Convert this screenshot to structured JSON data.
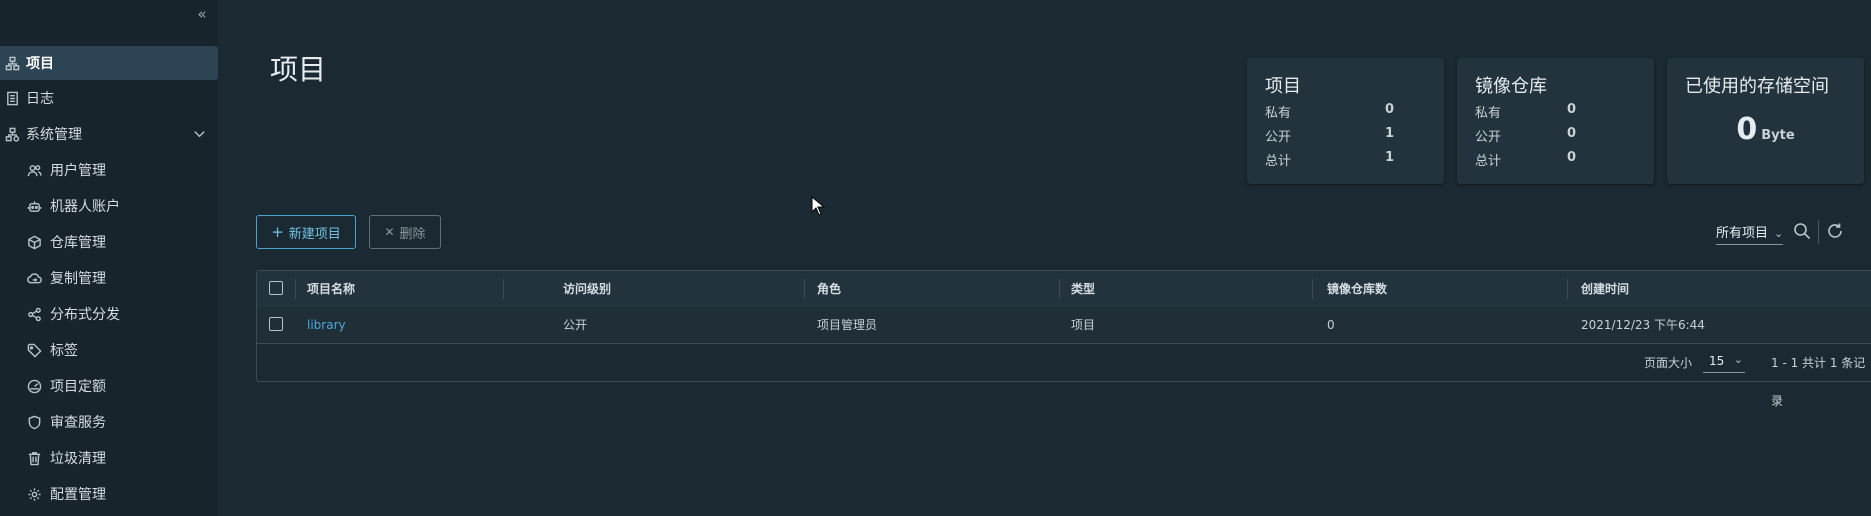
{
  "sidebar": {
    "items": [
      {
        "label": "项目",
        "icon": "projects-icon",
        "active": true
      },
      {
        "label": "日志",
        "icon": "logs-icon"
      },
      {
        "label": "系统管理",
        "icon": "admin-icon",
        "expanded": true
      },
      {
        "label": "用户管理",
        "icon": "users-icon"
      },
      {
        "label": "机器人账户",
        "icon": "robot-icon"
      },
      {
        "label": "仓库管理",
        "icon": "registry-icon"
      },
      {
        "label": "复制管理",
        "icon": "replication-icon"
      },
      {
        "label": "分布式分发",
        "icon": "share-icon"
      },
      {
        "label": "标签",
        "icon": "tag-icon"
      },
      {
        "label": "项目定额",
        "icon": "quota-icon"
      },
      {
        "label": "审查服务",
        "icon": "shield-icon"
      },
      {
        "label": "垃圾清理",
        "icon": "trash-icon"
      },
      {
        "label": "配置管理",
        "icon": "gear-icon"
      }
    ]
  },
  "main": {
    "title": "项目"
  },
  "cards": {
    "projects": {
      "title": "项目",
      "rows": [
        {
          "label": "私有",
          "value": "0"
        },
        {
          "label": "公开",
          "value": "1"
        },
        {
          "label": "总计",
          "value": "1"
        }
      ]
    },
    "repositories": {
      "title": "镜像仓库",
      "rows": [
        {
          "label": "私有",
          "value": "0"
        },
        {
          "label": "公开",
          "value": "0"
        },
        {
          "label": "总计",
          "value": "0"
        }
      ]
    },
    "storage": {
      "title": "已使用的存储空间",
      "value": "0",
      "unit": "Byte"
    }
  },
  "toolbar": {
    "new_label": "新建项目",
    "delete_label": "删除",
    "filter_label": "所有项目"
  },
  "table": {
    "columns": [
      "项目名称",
      "访问级别",
      "角色",
      "类型",
      "镜像仓库数",
      "创建时间"
    ],
    "rows": [
      {
        "name": "library",
        "access": "公开",
        "role": "项目管理员",
        "type": "项目",
        "repo_count": "0",
        "created": "2021/12/23 下午6:44"
      }
    ],
    "footer": {
      "page_size_label": "页面大小",
      "page_size": "15",
      "summary": "1 - 1 共计 1 条记录"
    }
  },
  "colors": {
    "background": "#1b2a32",
    "sidebar": "#17242c",
    "active_item": "#2c4454",
    "link": "#49a8dd",
    "primary_button": "#4aa3c8"
  }
}
